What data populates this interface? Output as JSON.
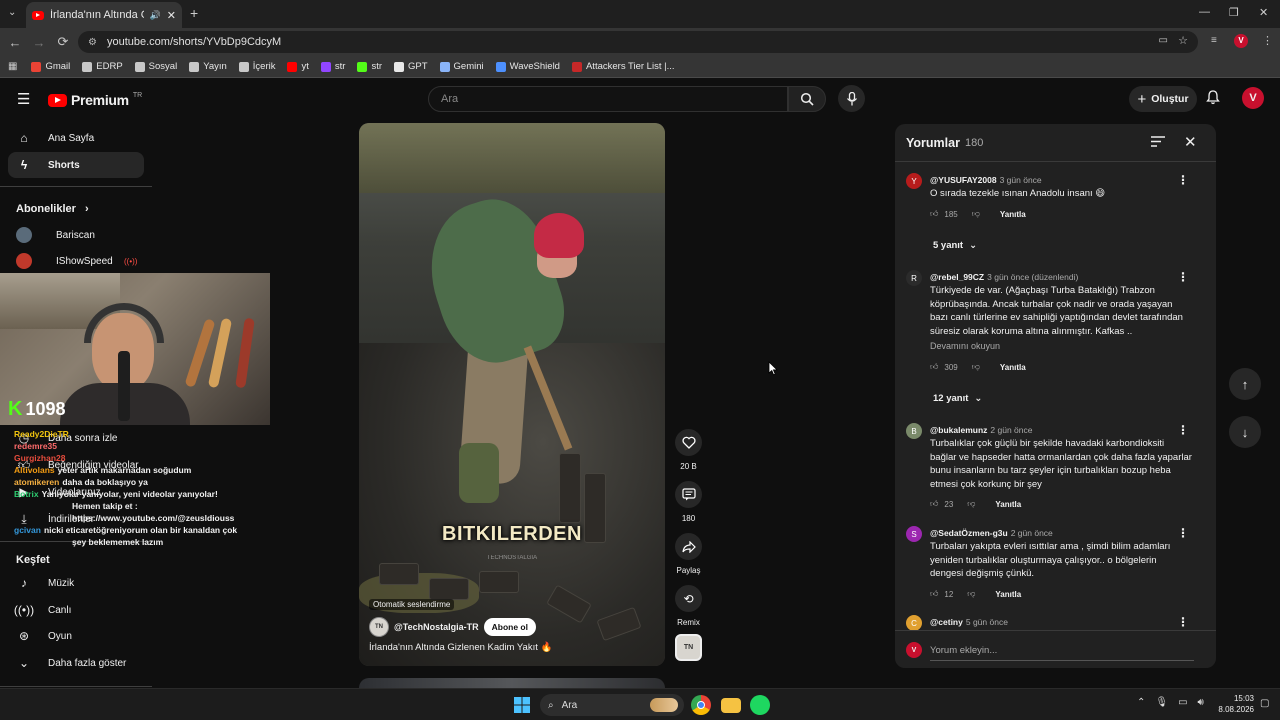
{
  "browser": {
    "tab_title": "İrlanda'nın Altında Gizlenen Kadim Yakıt",
    "url": "youtube.com/shorts/YVbDp9CdcyM",
    "bookmarks": [
      {
        "label": "Gmail",
        "color": "#ea4335"
      },
      {
        "label": "EDRP",
        "color": "#c8c8c8"
      },
      {
        "label": "Sosyal",
        "color": "#c8c8c8"
      },
      {
        "label": "Yayın",
        "color": "#c8c8c8"
      },
      {
        "label": "İçerik",
        "color": "#c8c8c8"
      },
      {
        "label": "yt",
        "color": "#ff0000"
      },
      {
        "label": "str",
        "color": "#9146ff"
      },
      {
        "label": "str",
        "color": "#53fc18"
      },
      {
        "label": "GPT",
        "color": "#e8e8e8"
      },
      {
        "label": "Gemini",
        "color": "#8ab4f8"
      },
      {
        "label": "WaveShield",
        "color": "#4d90fe"
      },
      {
        "label": "Attackers Tier List |...",
        "color": "#c62828"
      }
    ]
  },
  "header": {
    "logo_text": "Premium",
    "logo_region": "TR",
    "search_placeholder": "Ara",
    "create_label": "Oluştur",
    "avatar_letter": "V"
  },
  "sidebar": {
    "home": "Ana Sayfa",
    "shorts": "Shorts",
    "subscriptions_title": "Abonelikler",
    "subscriptions": [
      {
        "name": "Bariscan",
        "color": "#5a6b7a"
      },
      {
        "name": "IShowSpeed",
        "color": "#c0392b"
      }
    ],
    "watch_later": "Daha sonra izle",
    "liked": "Beğendiğim videolar",
    "your_videos": "Videolarınız",
    "downloads": "İndirilenler",
    "explore_title": "Keşfet",
    "explore": [
      "Müzik",
      "Canlı",
      "Oyun"
    ],
    "show_more": "Daha fazla göster"
  },
  "overlay": {
    "kick_viewers": "1098",
    "chat": [
      {
        "user": "Ready2DieTR",
        "color": "#f1c40f",
        "text": ""
      },
      {
        "user": "redemre35",
        "color": "#ff6b6b",
        "text": ""
      },
      {
        "user": "Gurgizhan28",
        "color": "#e74c3c",
        "text": ""
      },
      {
        "user": "Altivolans",
        "color": "#f39c12",
        "text": "yeter artık makarnadan soğudum"
      },
      {
        "user": "atomikeren",
        "color": "#f5b041",
        "text": "daha da boklaşıyo ya"
      },
      {
        "user": "Botrix",
        "color": "#2ecc71",
        "text": "Yanıyolar yanıyolar, yeni videolar yanıyolar!"
      },
      {
        "user": "",
        "color": "#ffffff",
        "text": "Hemen takip et :"
      },
      {
        "user": "",
        "color": "#ffffff",
        "text": "https://www.youtube.com/@zeusldiouss"
      },
      {
        "user": "gcivan",
        "color": "#3498db",
        "text": "nicki eticaretöğreniyorum olan bir kanaldan çok"
      },
      {
        "user": "",
        "color": "#ffffff",
        "text": "şey beklememek lazım"
      }
    ]
  },
  "video": {
    "caption": "BITKILERDEN",
    "watermark": "TECHNOSTALGIA",
    "auto_dub": "Otomatik seslendirme",
    "channel": "@TechNostalgia-TR",
    "channel_avatar": "TN",
    "subscribe": "Abone ol",
    "title": "İrlanda'nın Altında Gizlenen Kadim Yakıt 🔥"
  },
  "actions": {
    "likes": "20 B",
    "comments": "180",
    "share": "Paylaş",
    "remix": "Remix"
  },
  "comments": {
    "title": "Yorumlar",
    "count": "180",
    "input_placeholder": "Yorum ekleyin...",
    "reply_label": "Yanıtla",
    "items": [
      {
        "user": "@YUSUFAY2008",
        "time": "3 gün önce",
        "text": "O sırada tezekle ısınan Anadolu insanı 😄",
        "likes": "185",
        "replies": "5 yanıt",
        "avatar_color": "#b71c1c",
        "avatar": "Y"
      },
      {
        "user": "@rebel_99CZ",
        "time": "3 gün önce (düzenlendi)",
        "text": "Türkiyede de var. (Ağaçbaşı Turba Bataklığı) Trabzon köprübaşında. Ancak turbalar çok nadir ve orada yaşayan bazı canlı türlerine ev sahipliği yaptığından devlet tarafından süresiz olarak koruma altına alınmıştır. Kafkas ..",
        "read_more": "Devamını okuyun",
        "likes": "309",
        "replies": "12 yanıt",
        "avatar_color": "#2b2b2b",
        "avatar": "R"
      },
      {
        "user": "@bukalemunz",
        "time": "2 gün önce",
        "text": "Turbalıklar çok güçlü bir şekilde havadaki karbondioksiti bağlar ve hapseder hatta ormanlardan çok daha fazla yaparlar bunu insanların bu tarz şeyler için turbalıkları bozup heba etmesi çok korkunç bir şey",
        "likes": "23",
        "avatar_color": "#7a8a6a",
        "avatar": "B"
      },
      {
        "user": "@SedatÖzmen-g3u",
        "time": "2 gün önce",
        "text": "Turbaları yakıpta evleri ısıttılar ama , şimdi bilim adamları yeniden turbalıklar oluşturmaya çalışıyor.. o bölgelerin dengesi değişmiş çünkü.",
        "likes": "12",
        "avatar_color": "#9c27b0",
        "avatar": "S"
      },
      {
        "user": "@cetiny",
        "time": "5 gün önce",
        "avatar_color": "#e0a030",
        "avatar": "C"
      }
    ]
  },
  "taskbar": {
    "search_placeholder": "Ara",
    "time": "15:03",
    "date": "8.08.2026"
  }
}
